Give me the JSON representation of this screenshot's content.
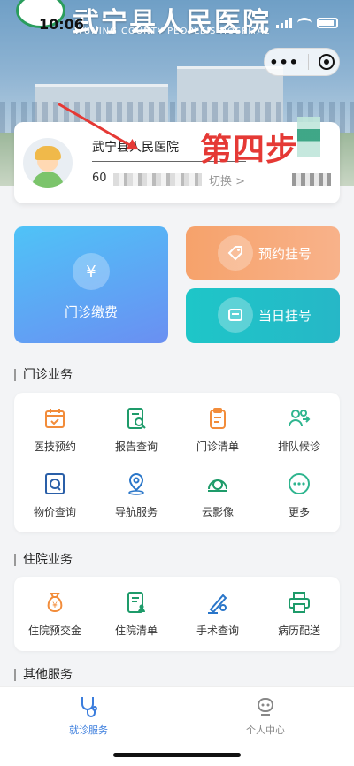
{
  "status_bar": {
    "time": "10:06"
  },
  "header": {
    "hospital_name": "武宁县人民医院",
    "hospital_name_en": "WUNING COUNTY PEOPLE'S HOSPITAL"
  },
  "capsule": {
    "more": "•••"
  },
  "patient": {
    "name": "武宁县人民医院",
    "id_prefix": "60",
    "switch_label": "切换 >"
  },
  "annotation": {
    "step_text": "第四步"
  },
  "services": {
    "pay_label": "门诊缴费",
    "appointment_label": "预约挂号",
    "today_label": "当日挂号",
    "pay_icon": "¥"
  },
  "outpatient": {
    "title": "门诊业务",
    "items": [
      {
        "label": "医技预约",
        "icon": "calendar-check-icon",
        "color": "#f28c3a"
      },
      {
        "label": "报告查询",
        "icon": "report-search-icon",
        "color": "#1e9b6a"
      },
      {
        "label": "门诊清单",
        "icon": "clipboard-list-icon",
        "color": "#f28c3a"
      },
      {
        "label": "排队候诊",
        "icon": "queue-people-icon",
        "color": "#2fb58f"
      },
      {
        "label": "物价查询",
        "icon": "price-search-icon",
        "color": "#2a5fa8"
      },
      {
        "label": "导航服务",
        "icon": "location-pin-icon",
        "color": "#2a76c9"
      },
      {
        "label": "云影像",
        "icon": "ct-scanner-icon",
        "color": "#1e9b6a"
      },
      {
        "label": "更多",
        "icon": "more-dots-icon",
        "color": "#2fb58f"
      }
    ]
  },
  "inpatient": {
    "title": "住院业务",
    "items": [
      {
        "label": "住院预交金",
        "icon": "money-bag-icon",
        "color": "#f28c3a"
      },
      {
        "label": "住院清单",
        "icon": "document-person-icon",
        "color": "#1e9b6a"
      },
      {
        "label": "手术查询",
        "icon": "scalpel-search-icon",
        "color": "#2a76c9"
      },
      {
        "label": "病历配送",
        "icon": "printer-icon",
        "color": "#1e9b6a"
      }
    ]
  },
  "other": {
    "title": "其他服务"
  },
  "nav": {
    "items": [
      {
        "label": "就诊服务",
        "active": true
      },
      {
        "label": "个人中心",
        "active": false
      }
    ],
    "active_color": "#3b7ddd",
    "inactive_color": "#888888"
  }
}
